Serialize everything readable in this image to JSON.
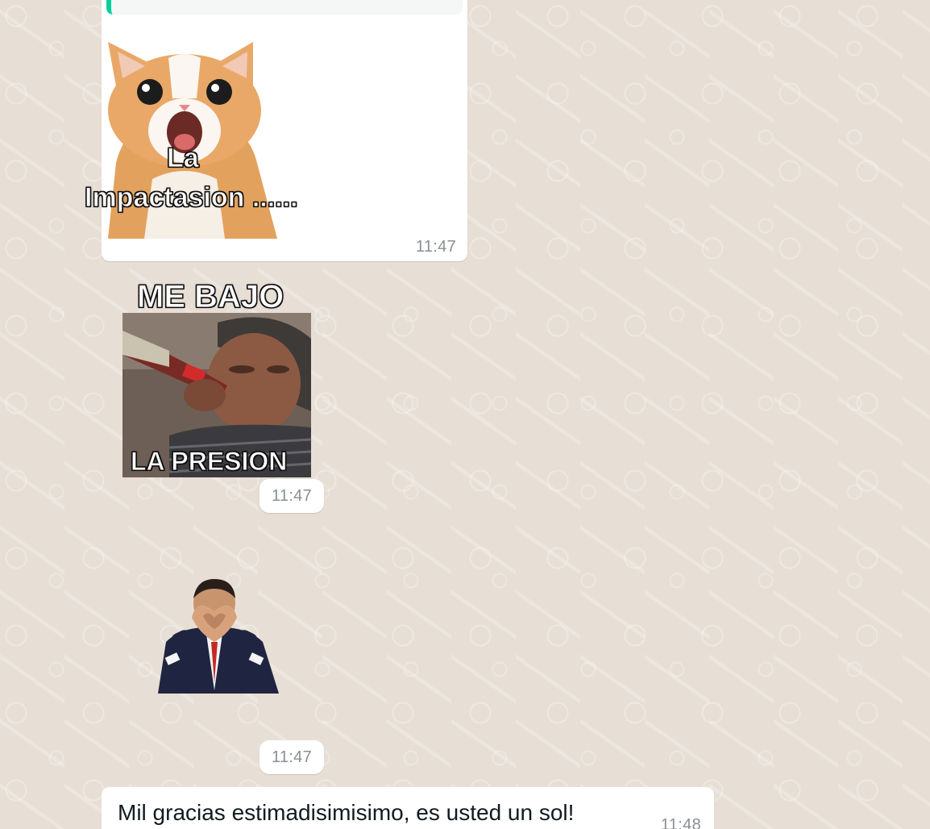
{
  "conversation": {
    "messages": [
      {
        "type": "sticker-reply",
        "caption_lines": [
          "La",
          "Impactasion ......"
        ],
        "time": "11:47"
      },
      {
        "type": "sticker",
        "caption_top": "ME BAJO",
        "caption_bottom": "LA PRESION",
        "time": "11:47"
      },
      {
        "type": "sticker",
        "time": "11:47"
      },
      {
        "type": "text",
        "text": "Mil gracias estimadisimisimo, es usted un sol!",
        "time": "11:48"
      }
    ]
  },
  "colors": {
    "wallpaper": "#e7dfd6",
    "bubble": "#ffffff",
    "quote_accent": "#06cf9c",
    "timestamp": "#8a9094",
    "text": "#111b21"
  }
}
